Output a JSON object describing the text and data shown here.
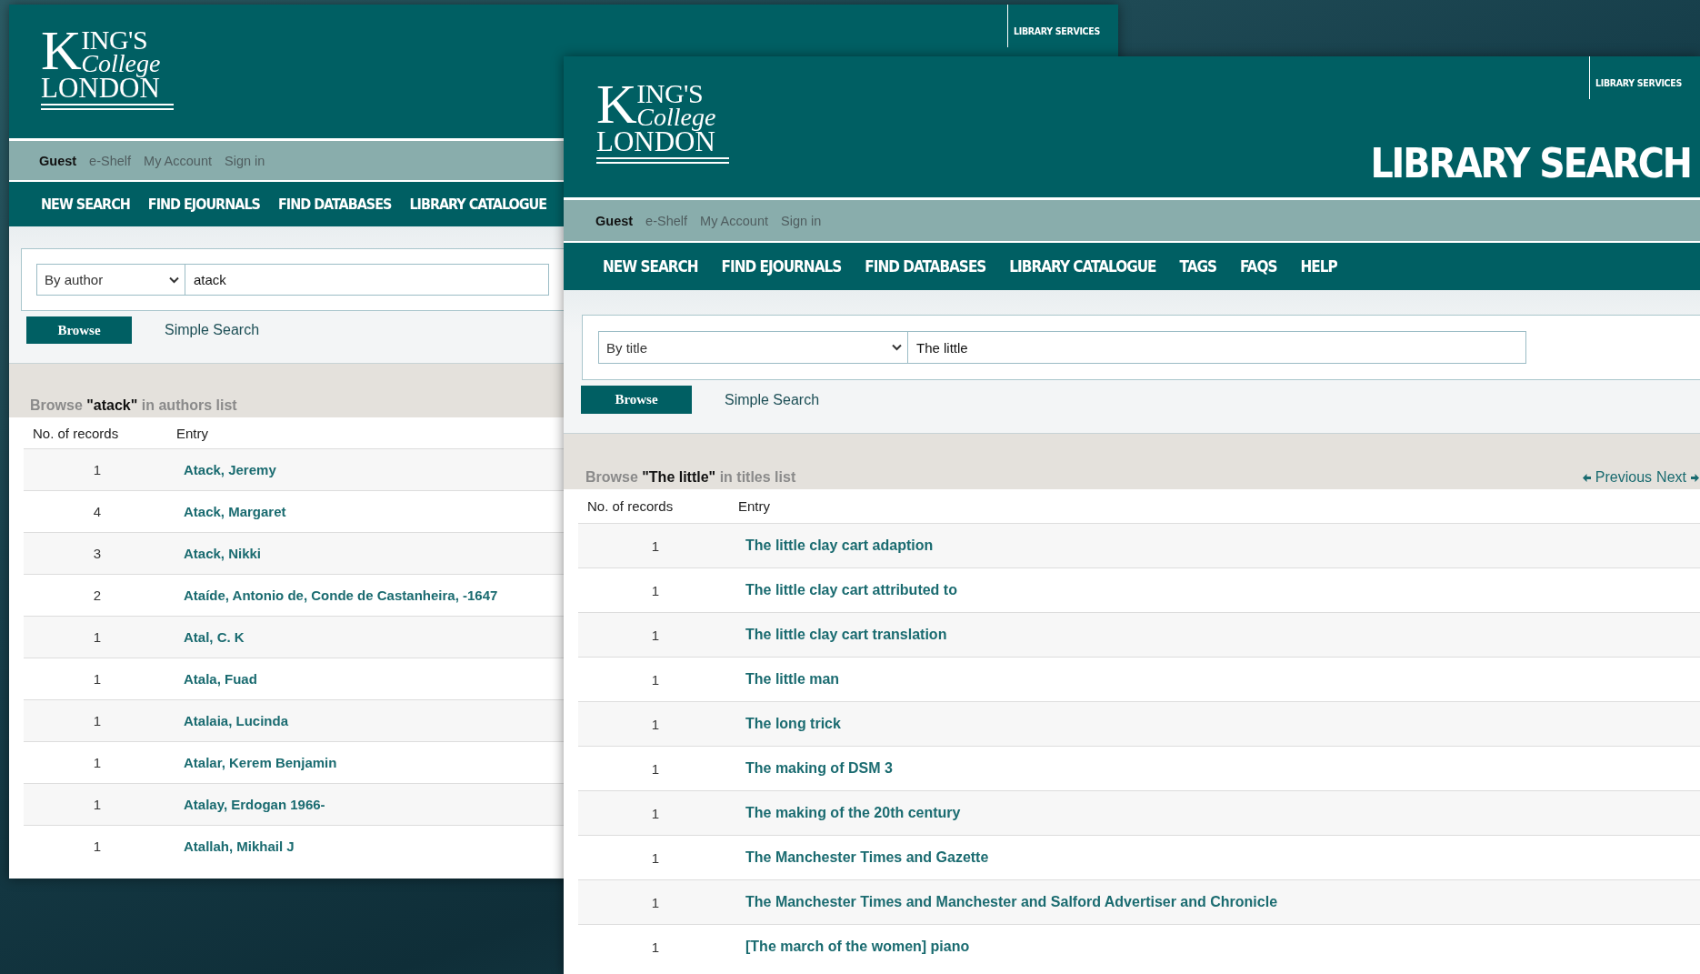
{
  "windows": [
    {
      "kind": "back",
      "logo": {
        "first": "KING'S",
        "second": "College",
        "third": "LONDON"
      },
      "library_services": "LIBRARY SERVICES",
      "user_bar": [
        {
          "kind": "user",
          "label": "Guest"
        },
        {
          "kind": "link",
          "label": "e-Shelf"
        },
        {
          "kind": "link",
          "label": "My Account"
        },
        {
          "kind": "link",
          "label": "Sign in"
        }
      ],
      "nav": [
        "NEW SEARCH",
        "FIND EJOURNALS",
        "FIND DATABASES",
        "LIBRARY CATALOGUE"
      ],
      "search": {
        "scope": "By author",
        "value": "atack"
      },
      "browse_button": "Browse",
      "simple_search": "Simple Search",
      "caption": "Browse **\"atack\"** in authors list",
      "columns": [
        "No. of records",
        "Entry"
      ],
      "rows": [
        {
          "count": "1",
          "entry": "Atack, Jeremy"
        },
        {
          "count": "4",
          "entry": "Atack, Margaret"
        },
        {
          "count": "3",
          "entry": "Atack, Nikki"
        },
        {
          "count": "2",
          "entry": "Ataíde, Antonio de, Conde de Castanheira, -1647"
        },
        {
          "count": "1",
          "entry": "Atal, C. K"
        },
        {
          "count": "1",
          "entry": "Atala, Fuad"
        },
        {
          "count": "1",
          "entry": "Atalaia, Lucinda"
        },
        {
          "count": "1",
          "entry": "Atalar, Kerem Benjamin"
        },
        {
          "count": "1",
          "entry": "Atalay, Erdogan 1966-"
        },
        {
          "count": "1",
          "entry": "Atallah, Mikhail J"
        }
      ]
    },
    {
      "kind": "front",
      "logo": {
        "first": "KING'S",
        "second": "College",
        "third": "LONDON"
      },
      "library_services": "LIBRARY SERVICES",
      "title": "LIBRARY SEARCH",
      "user_bar": [
        {
          "kind": "user",
          "label": "Guest"
        },
        {
          "kind": "link",
          "label": "e-Shelf"
        },
        {
          "kind": "link",
          "label": "My Account"
        },
        {
          "kind": "link",
          "label": "Sign in"
        }
      ],
      "nav": [
        "NEW SEARCH",
        "FIND EJOURNALS",
        "FIND DATABASES",
        "LIBRARY CATALOGUE",
        "TAGS",
        "FAQS",
        "HELP"
      ],
      "search": {
        "scope": "By title",
        "value": "The little"
      },
      "browse_button": "Browse",
      "simple_search": "Simple Search",
      "caption": "Browse **\"The little\"** in titles list",
      "pager": {
        "previous": "Previous",
        "next": "Next"
      },
      "columns": [
        "No. of records",
        "Entry"
      ],
      "rows": [
        {
          "count": "1",
          "entry": "The little clay cart adaption"
        },
        {
          "count": "1",
          "entry": "The little clay cart attributed to"
        },
        {
          "count": "1",
          "entry": "The little clay cart translation"
        },
        {
          "count": "1",
          "entry": "The little man"
        },
        {
          "count": "1",
          "entry": "The long trick"
        },
        {
          "count": "1",
          "entry": "The making of DSM 3"
        },
        {
          "count": "1",
          "entry": "The making of the 20th century"
        },
        {
          "count": "1",
          "entry": "The Manchester Times and Gazette"
        },
        {
          "count": "1",
          "entry": "The Manchester Times and Manchester and Salford Advertiser and Chronicle"
        },
        {
          "count": "1",
          "entry": "[The march of the women] piano"
        }
      ]
    }
  ]
}
